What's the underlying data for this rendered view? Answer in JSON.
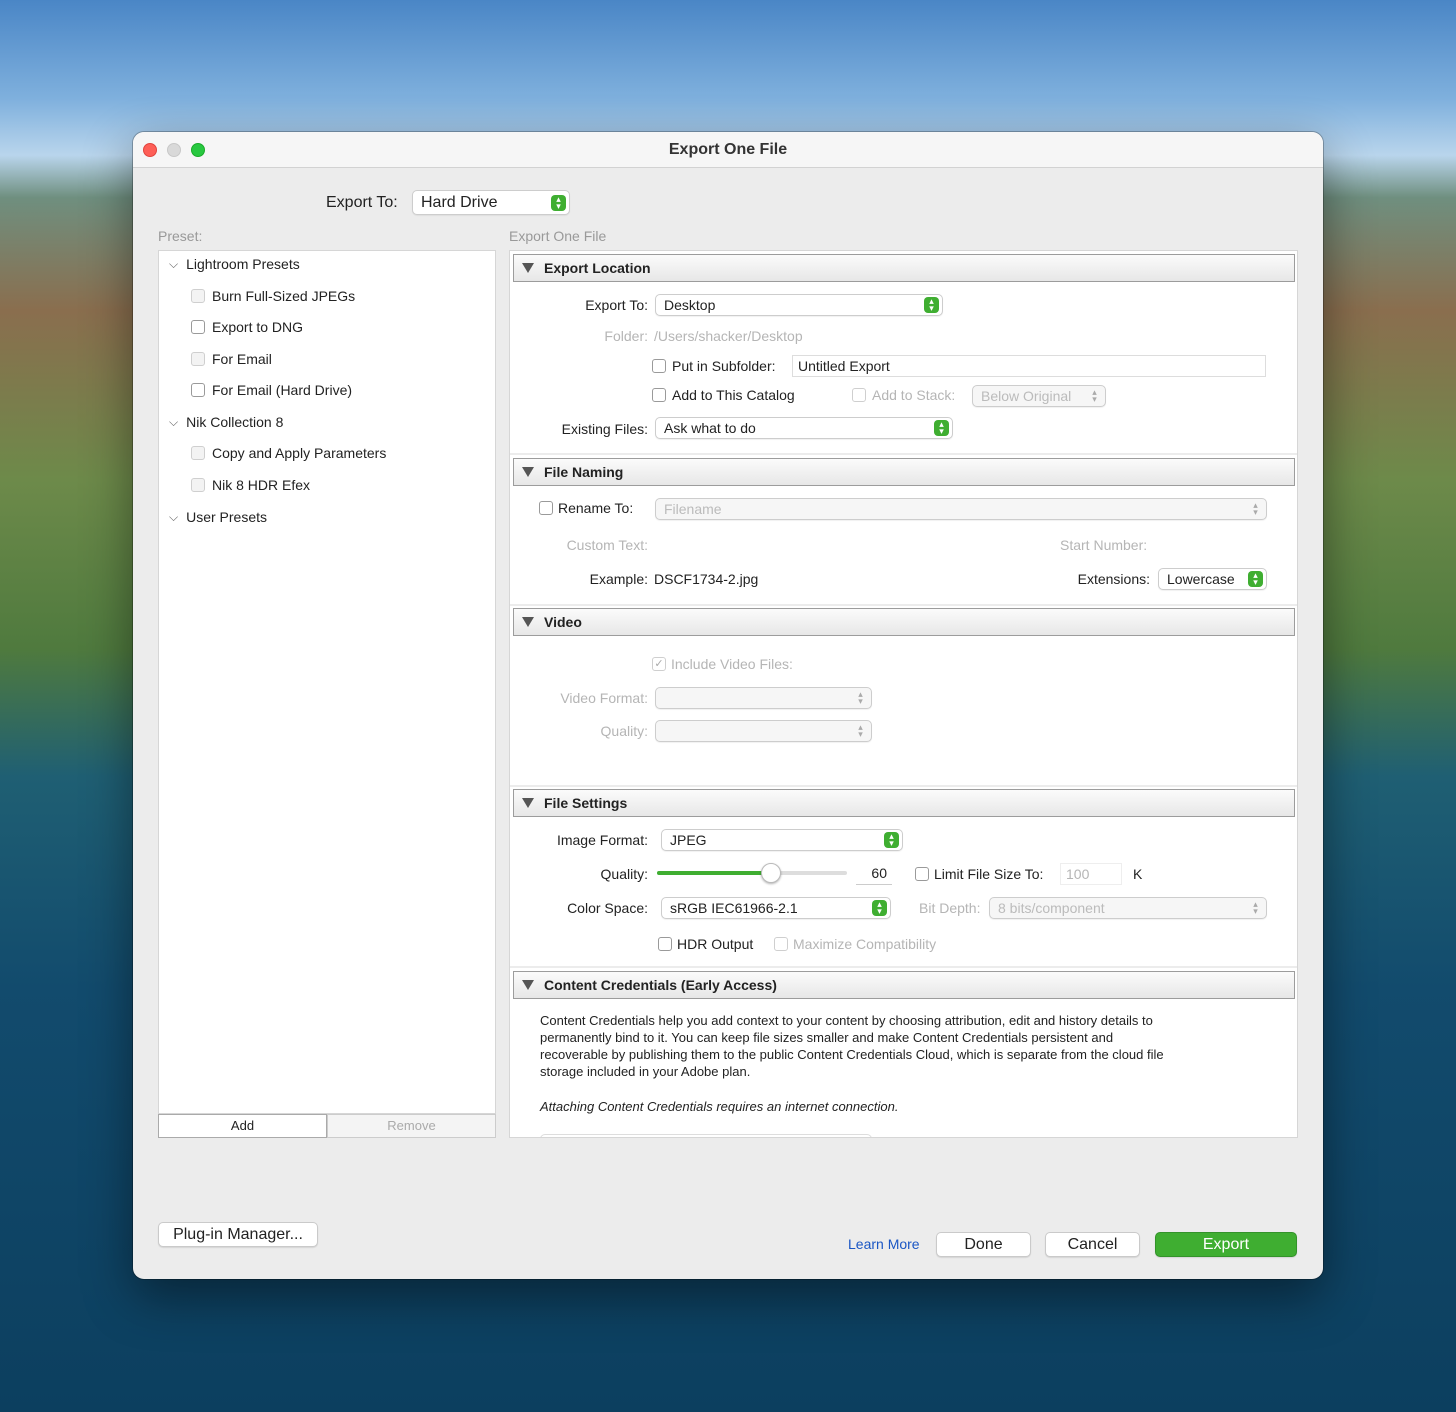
{
  "window": {
    "title": "Export One File"
  },
  "export_to": {
    "label": "Export To:",
    "value": "Hard Drive"
  },
  "preset": {
    "label": "Preset:",
    "groups": [
      {
        "name": "Lightroom Presets",
        "items": [
          "Burn Full-Sized JPEGs",
          "Export to DNG",
          "For Email",
          "For Email (Hard Drive)"
        ]
      },
      {
        "name": "Nik Collection 8",
        "items": [
          "Copy and Apply Parameters",
          "Nik 8 HDR Efex"
        ]
      },
      {
        "name": "User Presets",
        "items": []
      }
    ],
    "add": "Add",
    "remove": "Remove"
  },
  "main": {
    "header": "Export One File",
    "location": {
      "title": "Export Location",
      "export_to_label": "Export To:",
      "export_to_value": "Desktop",
      "folder_label": "Folder:",
      "folder_value": "/Users/shacker/Desktop",
      "subfolder_label": "Put in Subfolder:",
      "subfolder_value": "Untitled Export",
      "add_catalog": "Add to This Catalog",
      "add_stack": "Add to Stack:",
      "stack_value": "Below Original",
      "existing_label": "Existing Files:",
      "existing_value": "Ask what to do"
    },
    "naming": {
      "title": "File Naming",
      "rename_label": "Rename To:",
      "rename_value": "Filename",
      "custom_label": "Custom Text:",
      "start_label": "Start Number:",
      "example_label": "Example:",
      "example_value": "DSCF1734-2.jpg",
      "ext_label": "Extensions:",
      "ext_value": "Lowercase"
    },
    "video": {
      "title": "Video",
      "include": "Include Video Files:",
      "format_label": "Video Format:",
      "quality_label": "Quality:"
    },
    "file_settings": {
      "title": "File Settings",
      "format_label": "Image Format:",
      "format_value": "JPEG",
      "quality_label": "Quality:",
      "quality_value": "60",
      "quality_fraction": 0.6,
      "limit_label": "Limit File Size To:",
      "limit_value": "100",
      "limit_unit": "K",
      "color_label": "Color Space:",
      "color_value": "sRGB IEC61966-2.1",
      "bit_label": "Bit Depth:",
      "bit_value": "8 bits/component",
      "hdr": "HDR Output",
      "maxcompat": "Maximize Compatibility"
    },
    "credentials": {
      "title": "Content Credentials (Early Access)",
      "body": "Content Credentials help you add context to your content by choosing attribution, edit and history details to permanently bind to it. You can keep file sizes smaller and make Content Credentials persistent and recoverable by publishing them to the public Content Credentials Cloud, which is separate from the cloud file storage included in your Adobe plan.",
      "note": "Attaching Content Credentials requires an internet connection."
    }
  },
  "footer": {
    "plugin": "Plug-in Manager...",
    "learn": "Learn More",
    "done": "Done",
    "cancel": "Cancel",
    "export": "Export"
  },
  "colors": {
    "accent": "#3fae31",
    "close": "#fe5f57",
    "zoom": "#28c840"
  }
}
